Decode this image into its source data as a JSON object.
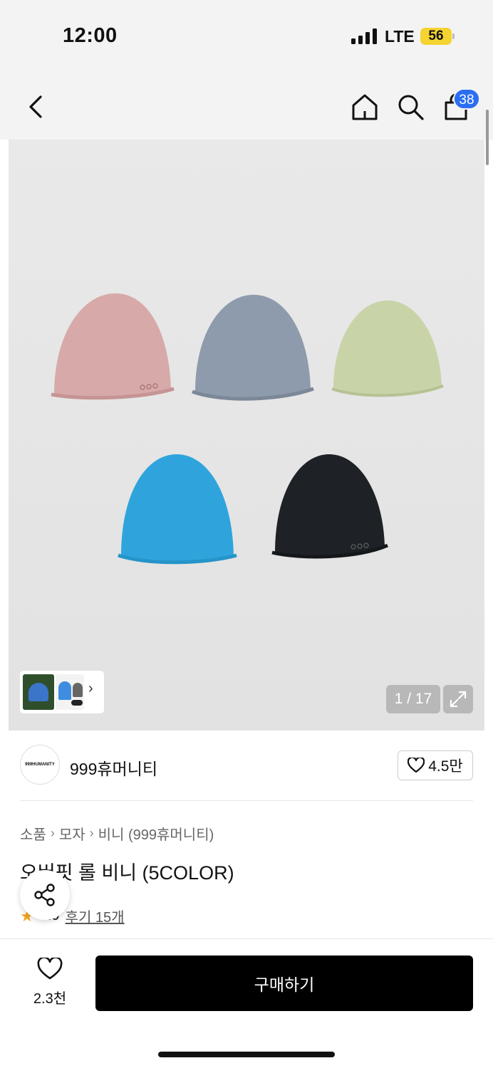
{
  "status_bar": {
    "time": "12:00",
    "network": "LTE",
    "battery": "56"
  },
  "header": {
    "cart_count": "38"
  },
  "gallery": {
    "page_counter": "1 / 17",
    "beanie_colors": [
      "#d8a9a9",
      "#8e9bac",
      "#c8d4a8",
      "#2fa4dc",
      "#1e2226"
    ]
  },
  "brand": {
    "logo_text": "999HUMANITY",
    "name": "999휴머니티",
    "likes": "4.5만"
  },
  "product": {
    "breadcrumb": [
      "소품",
      "모자",
      "비니 (999휴머니티)"
    ],
    "title": "오버핏 롤 비니 (5COLOR)",
    "rating": "4.9",
    "reviews": "후기 15개"
  },
  "bottom": {
    "wish_count": "2.3천",
    "buy_label": "구매하기"
  }
}
